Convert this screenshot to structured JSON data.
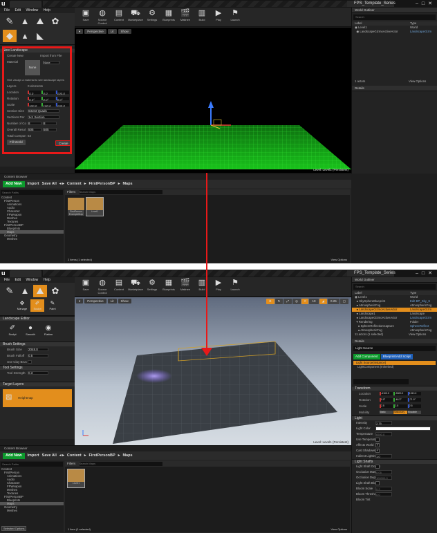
{
  "editor": {
    "logo": "u",
    "project_name": "FPS_Template_Series",
    "menu": [
      "File",
      "Edit",
      "Window",
      "Help"
    ],
    "toolbar": [
      "Save",
      "Source Control",
      "Content",
      "Marketplace",
      "Settings",
      "Blueprints",
      "Matinee",
      "Build",
      "Play",
      "Launch"
    ],
    "content_browser_title": "Content Browser",
    "add_new": "Add New",
    "import": "Import",
    "save_all": "Save All",
    "path": [
      "Content",
      "FirstPersonBP",
      "Maps"
    ],
    "filters": "Filters",
    "search_paths": "Search Paths",
    "search_assets": "Search Maps",
    "view_options": "View Options",
    "world_outliner": "World Outliner",
    "details": "Details",
    "outliner_search": "Search",
    "col_label": "Label",
    "col_type": "Type"
  },
  "top": {
    "landscape_title": "New Landscape",
    "create_new": "Create New",
    "import_from_file": "Import from File",
    "material_label": "Material",
    "material_none": "None",
    "material_hint": "Hint: Assign a material to see landscape layers",
    "layers_label": "Layers",
    "layers_value": "0 elements",
    "location_label": "Location",
    "location": [
      "0.0",
      "0.0",
      "100.0"
    ],
    "rotation_label": "Rotation",
    "rotation": [
      "0.0°",
      "0.0°",
      "0.0°"
    ],
    "scale_label": "Scale",
    "scale": [
      "100.0",
      "100.0",
      "100.0"
    ],
    "section_size_label": "Section Size",
    "section_size": "63x63 Quads",
    "sections_per_label": "Sections Per",
    "sections_per": "1x1 Section",
    "num_components_label": "Number of Co",
    "num_components": [
      "8",
      "8"
    ],
    "overall_res_label": "Overall Resol",
    "overall_res": [
      "505",
      "505"
    ],
    "total_components_label": "Total Compon",
    "total_components": "64",
    "fill_world": "Fill World",
    "create": "Create",
    "vp_perspective": "Perspective",
    "vp_lit": "Lit",
    "vp_show": "Show",
    "vp_level": "Level:  Level1 (Persistent)",
    "outliner_rows": [
      {
        "label": "Level1",
        "type": "World"
      },
      {
        "label": "LandscapeGizmoActiveActor",
        "type": "LandscapeGizm"
      }
    ],
    "actor_count": "1 actors",
    "cb_tree": [
      "Content",
      "FirstPerson",
      "Animations",
      "Audio",
      "Character",
      "FPWeapon",
      "Meshes",
      "Textures",
      "FirstPersonBP",
      "Blueprints",
      "Maps",
      "Geometry",
      "Meshes"
    ],
    "assets": [
      "FirstPerson ExampleMap",
      "Level1"
    ],
    "status": "2 items (1 selected)"
  },
  "bottom": {
    "landscape_editor": "Landscape Editor",
    "tools": [
      "Sculpt",
      "Smooth",
      "Flatten"
    ],
    "modes": [
      "Manage",
      "Sculpt",
      "Paint"
    ],
    "brush_settings": "Brush Settings",
    "brush_size_label": "Brush Size",
    "brush_size": "2048.0",
    "brush_falloff_label": "Brush Falloff",
    "brush_falloff": "0.5",
    "use_clay_label": "Use Clay Brus",
    "tool_settings": "Tool Settings",
    "tool_strength_label": "Tool Strength",
    "tool_strength": "0.3",
    "target_layers": "Target Layers",
    "heightmap": "Heightmap",
    "vp_level": "Level:  Level1 (Persistent)",
    "vp_speed": "0.25",
    "vp_grid": "10",
    "outliner_rows": [
      {
        "label": "Level1",
        "type": "World"
      },
      {
        "label": "SkySphereBlueprint",
        "type": "Edit BP_Sky_S"
      },
      {
        "label": "AtmosphericFog",
        "type": "AtmosphericFog"
      },
      {
        "label": "LandscapeGizmoActiveActor",
        "type": "LandscapeGizm"
      },
      {
        "label": "Landscape1",
        "type": "Landscape"
      },
      {
        "label": "LandscapeGizmoActiveActor",
        "type": "LandscapeGizm"
      },
      {
        "label": "Rendering",
        "type": "Folder"
      },
      {
        "label": "SphereReflectionCapture",
        "type": "SphereReflect"
      },
      {
        "label": "AtmosphericFog",
        "type": "AtmosphericFog"
      }
    ],
    "actor_count": "11 actors (1 selected)",
    "details_name": "Light Source",
    "add_component": "Add Component",
    "blueprint_add": "Blueprint/Add Script",
    "component_root": "Light Source(Instance)",
    "component_child": "LightComponent (Inherited)",
    "transform": "Transform",
    "location_label": "Location",
    "location": [
      "-4100.0",
      "-2600.0",
      "1310.0"
    ],
    "rotation_label": "Rotation",
    "rotation": [
      "0.0°",
      "-46.3°",
      "-71.9°"
    ],
    "scale_label": "Scale",
    "scale": [
      "2.5",
      "2.5",
      "2.5"
    ],
    "mobility_label": "Mobility",
    "mobility": [
      "Static",
      "Stationary",
      "Movable"
    ],
    "light_section": "Light",
    "intensity_label": "Intensity",
    "intensity": "2.75",
    "light_color_label": "Light Color",
    "temperature_label": "Temperature",
    "temperature": "6500.0",
    "use_temp_label": "Use Temperature",
    "affects_world_label": "Affects World",
    "cast_shadows_label": "Cast Shadows",
    "indirect_label": "Indirect Lighting In",
    "indirect": "1.0",
    "light_shafts": "Light Shafts",
    "shaft_occ_label": "Light Shaft Occlus",
    "occ_mask_label": "Occlusion Mask D",
    "occ_mask": "0.05",
    "occ_depth_label": "Occlusion Depth R",
    "occ_depth": "100000.0",
    "shaft_bloom_label": "Light Shaft Bloom",
    "bloom_scale_label": "Bloom Scale",
    "bloom_scale": "0.2",
    "bloom_threshold_label": "Bloom Threshold",
    "bloom_threshold": "0.0",
    "bloom_tint_label": "Bloom Tint",
    "cb_tree": [
      "Content",
      "FirstPerson",
      "Animations",
      "Audio",
      "Character",
      "FPWeapon",
      "Meshes",
      "Textures",
      "FirstPersonBP",
      "Blueprints",
      "Maps",
      "Geometry",
      "Meshes"
    ],
    "asset": "Level1",
    "selected_options": "Selected Options",
    "status": "1 item (1 selected)"
  },
  "colors": {
    "highlight": "#e81919",
    "add_green": "#0d9a2d",
    "selection": "#e38e1c",
    "grid": "#19c21b"
  }
}
